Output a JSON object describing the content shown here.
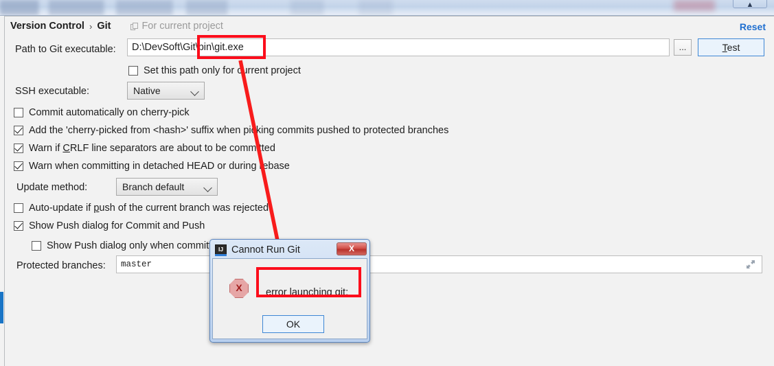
{
  "window": {
    "top_window_button": "chevron-up"
  },
  "header": {
    "breadcrumb_root": "Version Control",
    "breadcrumb_sep": "›",
    "breadcrumb_current": "Git",
    "scope_note": "For current project",
    "reset_label": "Reset"
  },
  "form": {
    "path_label": "Path to Git executable:",
    "path_value": "D:\\DevSoft\\Git\\bin\\git.exe",
    "browse_label": "...",
    "test_label_prefix": "",
    "test_label_underlined": "T",
    "test_label_rest": "est",
    "set_path_only_label": "Set this path only for current project",
    "ssh_label": "SSH executable:",
    "ssh_value": "Native",
    "update_method_label": "Update method:",
    "update_method_value": "Branch default",
    "protected_branches_label": "Protected branches:",
    "protected_branches_value": "master"
  },
  "checkboxes": [
    {
      "label": "Commit automatically on cherry-pick",
      "checked": false
    },
    {
      "label": "Add the 'cherry-picked from <hash>' suffix when picking commits pushed to protected branches",
      "checked": true
    },
    {
      "label_pre": "Warn if ",
      "label_underlined": "C",
      "label_post": "RLF line separators are about to be committed",
      "checked": true
    },
    {
      "label": "Warn when committing in detached HEAD or during rebase",
      "checked": true
    },
    {
      "label_pre": "Auto-update if ",
      "label_underlined": "p",
      "label_post": "ush of the current branch was rejected",
      "checked": false
    },
    {
      "label": "Show Push dialog for Commit and Push",
      "checked": true
    },
    {
      "label": "Show Push dialog only when committing",
      "checked": false
    }
  ],
  "dialog": {
    "title": "Cannot Run Git",
    "close_label": "X",
    "error_icon_glyph": "X",
    "message": "error launching git:",
    "ok_label": "OK"
  },
  "annotations": {
    "highlight_color": "#fc0d1b",
    "arrow_color": "#f81c1c"
  }
}
